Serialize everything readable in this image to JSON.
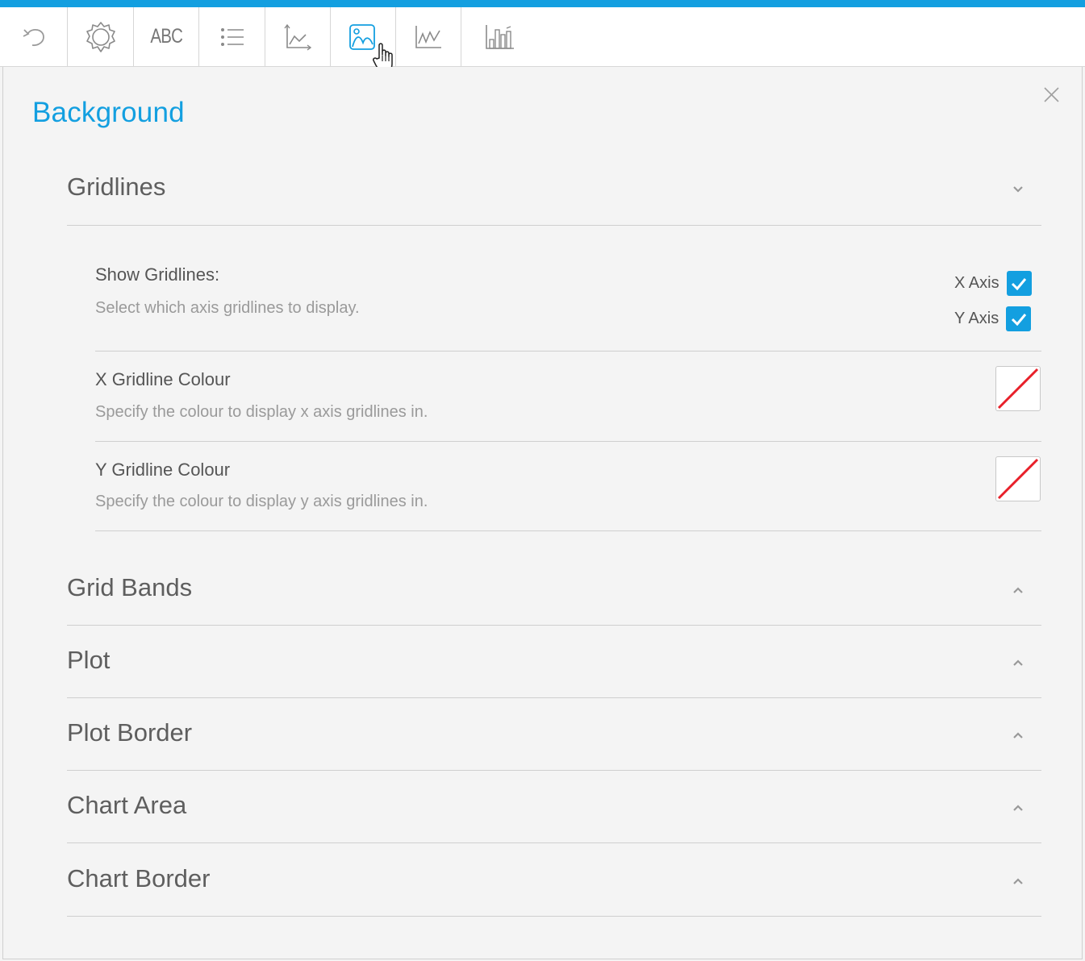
{
  "toolbar": {
    "abc_label": "ABC",
    "buttons": [
      {
        "name": "undo-button",
        "icon": "undo-icon"
      },
      {
        "name": "settings-button",
        "icon": "gear-icon"
      },
      {
        "name": "text-button",
        "icon": "abc-icon"
      },
      {
        "name": "legend-button",
        "icon": "list-icon"
      },
      {
        "name": "axes-button",
        "icon": "axis-icon"
      },
      {
        "name": "background-button",
        "icon": "image-icon",
        "active": true
      },
      {
        "name": "series-button",
        "icon": "line-chart-icon"
      },
      {
        "name": "bar-chart-button",
        "icon": "bar-chart-icon"
      }
    ],
    "accent_color": "#139fe0"
  },
  "panel": {
    "title": "Background",
    "close_icon": "close-icon"
  },
  "gridlines": {
    "title": "Gridlines",
    "expanded": true,
    "show": {
      "label": "Show Gridlines:",
      "description": "Select which axis gridlines to display.",
      "x_label": "X Axis",
      "x_checked": true,
      "y_label": "Y Axis",
      "y_checked": true
    },
    "x_colour": {
      "label": "X Gridline Colour",
      "description": "Specify the colour to display x axis gridlines in.",
      "value": "none"
    },
    "y_colour": {
      "label": "Y Gridline Colour",
      "description": "Specify the colour to display y axis gridlines in.",
      "value": "none"
    }
  },
  "sections": [
    {
      "title": "Grid Bands",
      "expanded": false
    },
    {
      "title": "Plot",
      "expanded": false
    },
    {
      "title": "Plot Border",
      "expanded": false
    },
    {
      "title": "Chart Area",
      "expanded": false
    },
    {
      "title": "Chart Border",
      "expanded": false
    }
  ]
}
